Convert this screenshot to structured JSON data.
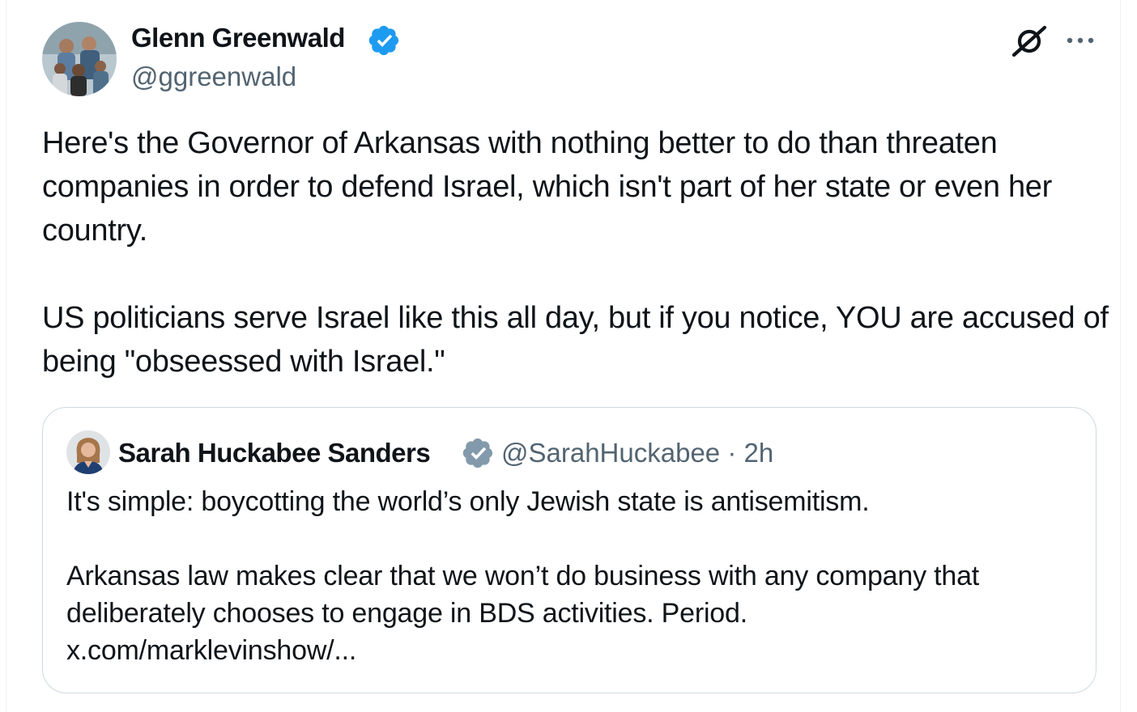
{
  "tweet": {
    "author_name": "Glenn Greenwald",
    "author_handle": "@ggreenwald",
    "text": "Here's the Governor of Arkansas with nothing better to do than threaten companies in order to defend Israel, which isn't part of her state or even her country.\n\nUS politicians serve Israel like this all day, but if you notice, YOU are accused of being \"obseessed with Israel.\"",
    "icons": {
      "verified": "verified-badge-icon",
      "grok": "grok-icon",
      "more": "more-options-icon"
    },
    "colors": {
      "verified_blue": "#1d9bf0",
      "verified_gray": "#829aab",
      "secondary_text": "#536471",
      "border": "#cfd9de"
    }
  },
  "quoted": {
    "author_name": "Sarah Huckabee Sanders",
    "meta": "@SarahHuckabee · 2h",
    "text": "It's simple: boycotting the world’s only Jewish state is antisemitism.\n\nArkansas law makes clear that we won’t do business with any company that deliberately chooses to engage in BDS activities. Period.\nx.com/marklevinshow/..."
  }
}
